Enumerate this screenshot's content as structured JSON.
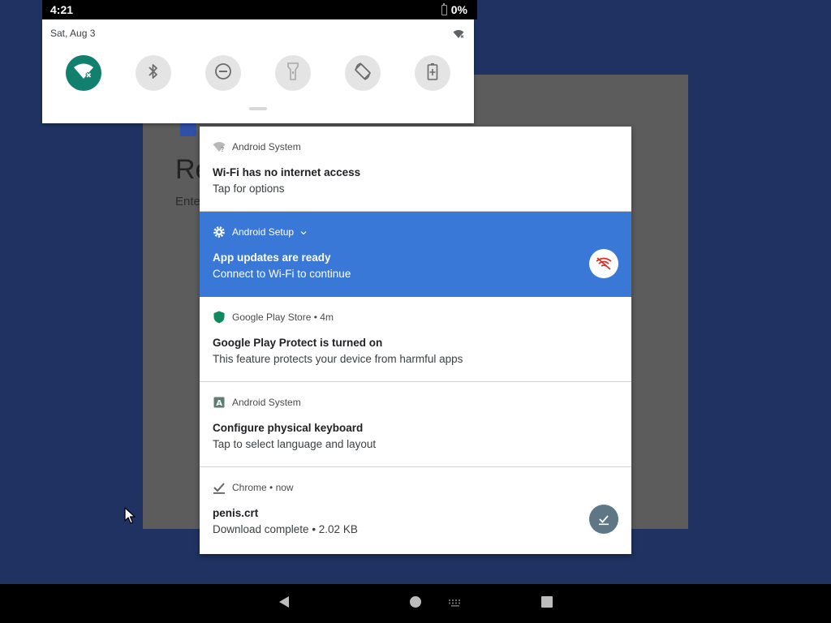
{
  "status_bar": {
    "time": "4:21",
    "battery_percent": "0%",
    "battery_icon": "battery-icon"
  },
  "quick_settings": {
    "date": "Sat, Aug 3",
    "wifi_status_icon": "wifi-no-internet-icon",
    "tiles": [
      {
        "name": "wifi",
        "icon": "wifi-no-internet-icon",
        "active": true
      },
      {
        "name": "bluetooth",
        "icon": "bluetooth-icon",
        "active": false
      },
      {
        "name": "do-not-disturb",
        "icon": "dnd-icon",
        "active": false
      },
      {
        "name": "flashlight",
        "icon": "flashlight-icon",
        "active": false
      },
      {
        "name": "auto-rotate",
        "icon": "rotate-icon",
        "active": false
      },
      {
        "name": "battery-saver",
        "icon": "battery-saver-icon",
        "active": false
      }
    ],
    "accent_color": "#12806f"
  },
  "background_app": {
    "title": "Re",
    "subtitle": "Ente"
  },
  "notifications": [
    {
      "app": "Android System",
      "icon": "wifi-question-icon",
      "title": "Wi-Fi has no internet access",
      "text": "Tap for options"
    },
    {
      "app": "Android Setup",
      "icon": "gear-icon",
      "expand_icon": "chevron-down-icon",
      "title": "App updates are ready",
      "text": "Connect to Wi-Fi to continue",
      "action_icon": "wifi-off-icon",
      "highlight_color": "#3a78d8"
    },
    {
      "app": "Google Play Store",
      "time": "4m",
      "icon": "shield-icon",
      "title": "Google Play Protect is turned on",
      "text": "This feature protects your device from harmful apps"
    },
    {
      "app": "Android System",
      "icon": "keyboard-a-icon",
      "title": "Configure physical keyboard",
      "text": "Tap to select language and layout"
    },
    {
      "app": "Chrome",
      "time": "now",
      "icon": "download-done-icon",
      "title": "penis.crt",
      "text": "Download complete • 2.02 KB",
      "action_icon": "download-done-icon"
    }
  ],
  "nav_bar": {
    "back_icon": "back-icon",
    "home_icon": "home-icon",
    "keyboard_icon": "keyboard-icon",
    "recents_icon": "recents-icon"
  },
  "separator": " • "
}
